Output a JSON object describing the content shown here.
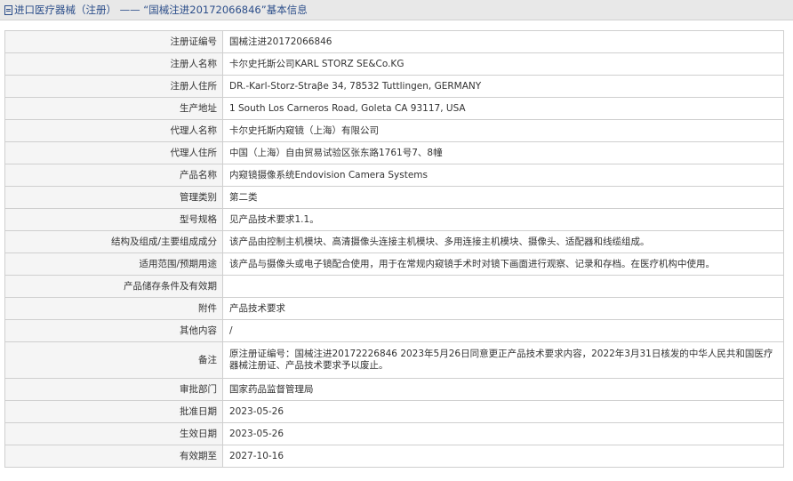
{
  "header": {
    "title": "进口医疗器械（注册） —— “国械注进20172066846”基本信息",
    "icon": "document-icon"
  },
  "rows": [
    {
      "key": "registration-number",
      "label": "注册证编号",
      "value": "国械注进20172066846"
    },
    {
      "key": "registrant-name",
      "label": "注册人名称",
      "value": "卡尔史托斯公司KARL STORZ SE&Co.KG"
    },
    {
      "key": "registrant-address",
      "label": "注册人住所",
      "value": "DR.-Karl-Storz-Straβe 34, 78532 Tuttlingen, GERMANY"
    },
    {
      "key": "production-address",
      "label": "生产地址",
      "value": "1 South Los Carneros Road, Goleta CA 93117, USA"
    },
    {
      "key": "agent-name",
      "label": "代理人名称",
      "value": "卡尔史托斯内窥镜（上海）有限公司"
    },
    {
      "key": "agent-address",
      "label": "代理人住所",
      "value": "中国（上海）自由贸易试验区张东路1761号7、8幢"
    },
    {
      "key": "product-name",
      "label": "产品名称",
      "value": "内窥镜摄像系统Endovision Camera Systems"
    },
    {
      "key": "management-class",
      "label": "管理类别",
      "value": "第二类"
    },
    {
      "key": "model-spec",
      "label": "型号规格",
      "value": "见产品技术要求1.1。"
    },
    {
      "key": "structure-composition",
      "label": "结构及组成/主要组成成分",
      "value": "该产品由控制主机模块、高清摄像头连接主机模块、多用连接主机模块、摄像头、适配器和线缆组成。"
    },
    {
      "key": "scope-of-use",
      "label": "适用范围/预期用途",
      "value": "该产品与摄像头或电子镜配合使用，用于在常规内窥镜手术时对镜下画面进行观察、记录和存档。在医疗机构中使用。"
    },
    {
      "key": "storage-conditions",
      "label": "产品储存条件及有效期",
      "value": ""
    },
    {
      "key": "attachment",
      "label": "附件",
      "value": "产品技术要求"
    },
    {
      "key": "other-content",
      "label": "其他内容",
      "value": "/"
    },
    {
      "key": "remarks",
      "label": "备注",
      "value": "原注册证编号：国械注进20172226846 2023年5月26日同意更正产品技术要求内容，2022年3月31日核发的中华人民共和国医疗器械注册证、产品技术要求予以废止。"
    },
    {
      "key": "approval-department",
      "label": "审批部门",
      "value": "国家药品监督管理局"
    },
    {
      "key": "approval-date",
      "label": "批准日期",
      "value": "2023-05-26"
    },
    {
      "key": "effective-date",
      "label": "生效日期",
      "value": "2023-05-26"
    },
    {
      "key": "valid-until",
      "label": "有效期至",
      "value": "2027-10-16"
    }
  ]
}
